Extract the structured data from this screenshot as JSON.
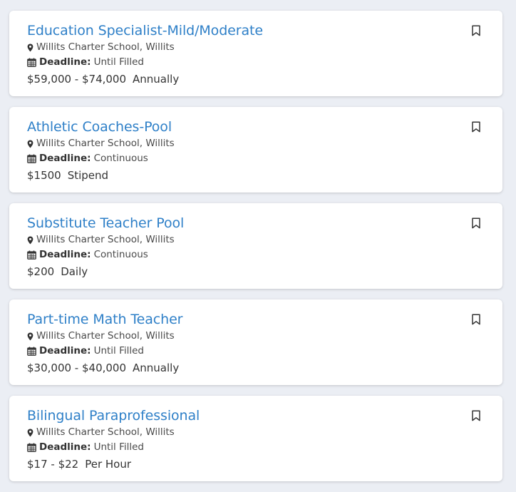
{
  "jobs": [
    {
      "title": "Education Specialist-Mild/Moderate",
      "location": "Willits Charter School, Willits",
      "deadline_label": "Deadline:",
      "deadline": "Until Filled",
      "salary": "$59,000 - $74,000",
      "period": "Annually"
    },
    {
      "title": "Athletic Coaches-Pool",
      "location": "Willits Charter School, Willits",
      "deadline_label": "Deadline:",
      "deadline": "Continuous",
      "salary": "$1500",
      "period": "Stipend"
    },
    {
      "title": "Substitute Teacher Pool",
      "location": "Willits Charter School, Willits",
      "deadline_label": "Deadline:",
      "deadline": "Continuous",
      "salary": "$200",
      "period": "Daily"
    },
    {
      "title": "Part-time Math Teacher",
      "location": "Willits Charter School, Willits",
      "deadline_label": "Deadline:",
      "deadline": "Until Filled",
      "salary": "$30,000 - $40,000",
      "period": "Annually"
    },
    {
      "title": "Bilingual Paraprofessional",
      "location": "Willits Charter School, Willits",
      "deadline_label": "Deadline:",
      "deadline": "Until Filled",
      "salary": "$17 - $22",
      "period": "Per Hour"
    }
  ],
  "icons": {
    "location": "map-marker-icon",
    "deadline": "calendar-icon",
    "save": "bookmark-icon"
  },
  "colors": {
    "title": "#2f80c8",
    "background": "#ebeef4",
    "card": "#ffffff"
  }
}
